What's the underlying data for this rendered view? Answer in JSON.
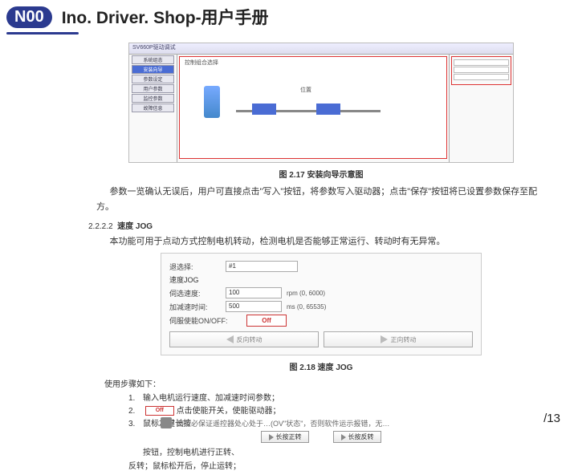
{
  "header": {
    "logo": "N00",
    "title": "Ino. Driver. Shop-用户手册"
  },
  "fig1": {
    "toolbar": "SV660P驱动调试",
    "sidebar": [
      "系统组态",
      "安装向导",
      "参数设定",
      "用户参数",
      "监控参数",
      "故障信息"
    ],
    "mainTitle": "控制组合选择",
    "labelPos": "位置",
    "caption": "图 2.17 安装向导示意图"
  },
  "para1": "参数一览确认无误后，用户可直接点击\"写入\"按钮，将参数写入驱动器；点击\"保存\"按钮将已设置参数保存至配方。",
  "section": {
    "num": "2.2.2.2",
    "title": "速度 JOG"
  },
  "para2": "本功能可用于点动方式控制电机转动，检测电机是否能够正常运行、转动时有无异常。",
  "fig2": {
    "row0": {
      "label": "退选择:",
      "value": "#1"
    },
    "heading": "速度JOG",
    "speed": {
      "label": "伺选速度:",
      "value": "100",
      "unit": "rpm (0, 6000)"
    },
    "accdec": {
      "label": "加减速时间:",
      "value": "500",
      "unit": "ms (0, 65535)"
    },
    "servo": {
      "label": "伺服使能ON/OFF:",
      "btn": "Off"
    },
    "leftBtn": "反向转动",
    "rightBtn": "正向转动",
    "caption": "图 2.18 速度 JOG"
  },
  "steps": {
    "heading": "使用步骤如下：",
    "s1": "输入电机运行速度、加减速时间参数；",
    "s2": "点击使能开关，使能驱动器；",
    "s2off": "Off",
    "s3": "鼠标左键长按",
    "s3a": "长按正转",
    "s3b": "长按反转",
    "s3tail": "按钮，控制电机进行正转、",
    "s4": "反转；鼠标松开后，停止运转；"
  },
  "footerText": "请务必保证遥控器处心处于…(OV\"状态\"，否则软件运示报错，无法运行。",
  "pageNum": "/13"
}
